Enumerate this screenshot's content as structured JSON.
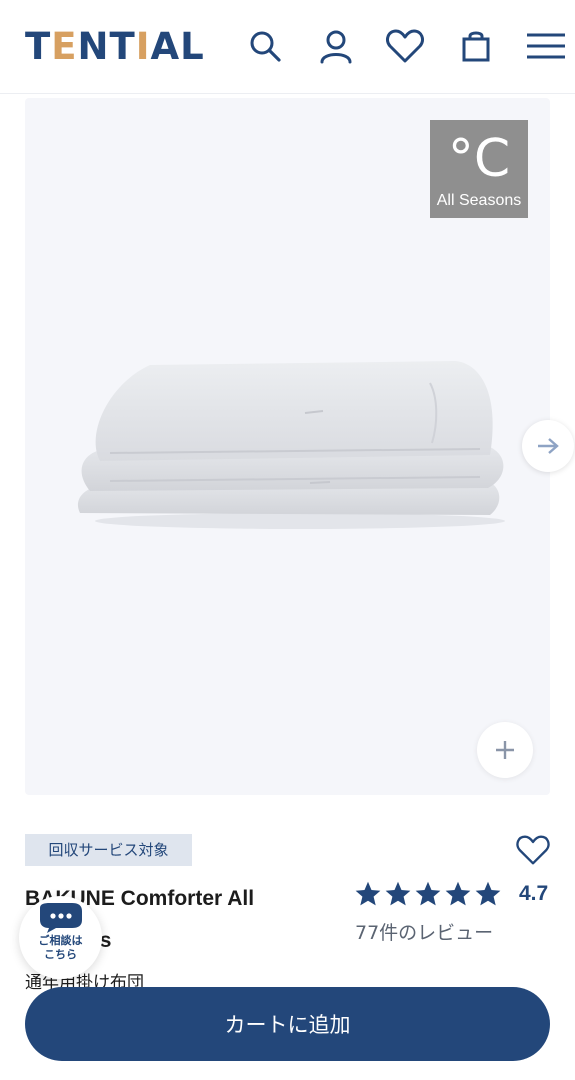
{
  "header": {
    "logo_prefix": "T",
    "logo_accent": "E",
    "logo_mid": "NT",
    "logo_accent2": "I",
    "logo_rest": "AL",
    "icons": [
      "search-icon",
      "account-icon",
      "heart-icon",
      "bag-icon",
      "menu-icon"
    ]
  },
  "gallery": {
    "badge_symbol": "°C",
    "badge_label": "All Seasons",
    "image": "folded-comforter-image"
  },
  "product": {
    "tag": "回収サービス対象",
    "name": "BAKUNE Comforter All Seasons",
    "rating": "4.7",
    "stars": 5,
    "reviews": "77件のレビュー",
    "subtitle": "通年用掛け布団"
  },
  "chat": {
    "label_line1": "ご相談は",
    "label_line2": "こちら"
  },
  "cart": {
    "button_label": "カートに追加"
  },
  "colors": {
    "brand": "#23477a",
    "accent": "#d7a061",
    "tag_bg": "#dfe5ee",
    "badge_bg": "#8f8f8f"
  }
}
